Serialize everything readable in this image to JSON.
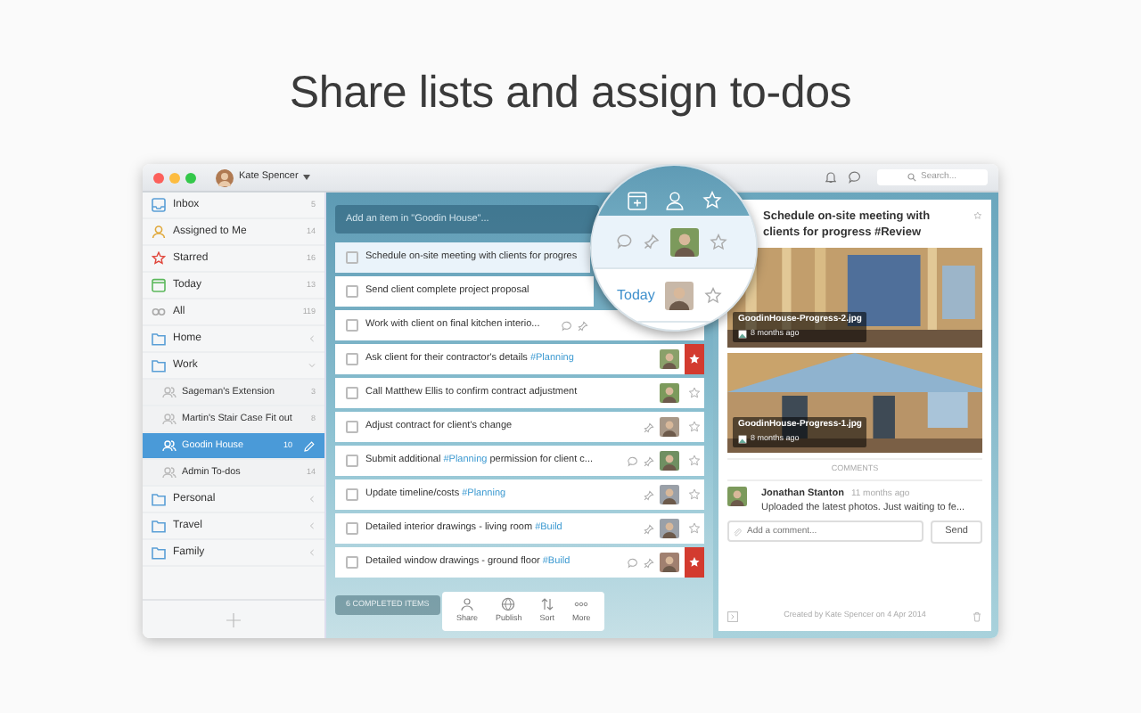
{
  "headline": "Share lists and assign to-dos",
  "window": {
    "user": "Kate Spencer",
    "search_placeholder": "Search..."
  },
  "sidebar": {
    "items": [
      {
        "label": "Inbox",
        "count": "5",
        "kind": "inbox",
        "selected": false
      },
      {
        "label": "Assigned to Me",
        "count": "14",
        "kind": "assigned",
        "selected": false
      },
      {
        "label": "Starred",
        "count": "16",
        "kind": "starred",
        "selected": false
      },
      {
        "label": "Today",
        "count": "13",
        "kind": "today",
        "selected": false
      },
      {
        "label": "All",
        "count": "119",
        "kind": "all",
        "selected": false
      },
      {
        "label": "Home",
        "kind": "folder",
        "expanded": false,
        "selected": false
      },
      {
        "label": "Work",
        "kind": "folder",
        "expanded": true,
        "selected": false,
        "children": [
          {
            "label": "Sageman's Extension",
            "count": "3",
            "kind": "shared",
            "selected": false
          },
          {
            "label": "Martin's Stair Case Fit out",
            "count": "8",
            "kind": "shared",
            "selected": false
          },
          {
            "label": "Goodin House",
            "count": "10",
            "kind": "shared",
            "selected": true
          },
          {
            "label": "Admin To-dos",
            "count": "14",
            "kind": "shared",
            "selected": false
          }
        ]
      },
      {
        "label": "Personal",
        "kind": "folder",
        "expanded": false,
        "selected": false
      },
      {
        "label": "Travel",
        "kind": "folder",
        "expanded": false,
        "selected": false
      },
      {
        "label": "Family",
        "kind": "folder",
        "expanded": false,
        "selected": false
      }
    ]
  },
  "list": {
    "add_placeholder": "Add an item in \"Goodin House\"...",
    "rows": [
      {
        "segments": [
          {
            "text": "Schedule on-site meeting with clients for progres",
            "kind": "plain"
          }
        ],
        "selected": true
      },
      {
        "segments": [
          {
            "text": "Send client complete project proposal",
            "kind": "plain"
          }
        ],
        "selected": false
      },
      {
        "segments": [
          {
            "text": "Work with client on final kitchen interio...",
            "kind": "plain"
          }
        ],
        "selected": false,
        "comment": true,
        "pin": true,
        "avatar": false
      },
      {
        "segments": [
          {
            "text": "Ask client for their contractor's details ",
            "kind": "plain"
          },
          {
            "text": "#Planning",
            "kind": "tag"
          }
        ],
        "selected": false,
        "avatar": true,
        "starred": true
      },
      {
        "segments": [
          {
            "text": "Call Matthew Ellis to confirm contract adjustment",
            "kind": "plain"
          }
        ],
        "selected": false,
        "avatar": true,
        "starred": false
      },
      {
        "segments": [
          {
            "text": "Adjust contract for client's change",
            "kind": "plain"
          }
        ],
        "selected": false,
        "pin": true,
        "avatar": true,
        "starred": false
      },
      {
        "segments": [
          {
            "text": "Submit additional ",
            "kind": "plain"
          },
          {
            "text": "#Planning",
            "kind": "tag"
          },
          {
            "text": " permission for client c...",
            "kind": "plain"
          }
        ],
        "selected": false,
        "comment": true,
        "pin": true,
        "avatar": true,
        "starred": false
      },
      {
        "segments": [
          {
            "text": "Update timeline/costs ",
            "kind": "plain"
          },
          {
            "text": "#Planning",
            "kind": "tag"
          }
        ],
        "selected": false,
        "pin": true,
        "avatar": true,
        "starred": false
      },
      {
        "segments": [
          {
            "text": "Detailed interior drawings - living room ",
            "kind": "plain"
          },
          {
            "text": "#Build",
            "kind": "tag"
          }
        ],
        "selected": false,
        "pin": true,
        "avatar": true,
        "starred": false
      },
      {
        "segments": [
          {
            "text": "Detailed window drawings - ground floor ",
            "kind": "plain"
          },
          {
            "text": "#Build",
            "kind": "tag"
          }
        ],
        "selected": false,
        "comment": true,
        "pin": true,
        "avatar": true,
        "starred": true
      }
    ],
    "completed_button": "6 COMPLETED ITEMS",
    "toolbar": [
      {
        "label": "Share",
        "kind": "share"
      },
      {
        "label": "Publish",
        "kind": "publish"
      },
      {
        "label": "Sort",
        "kind": "sort"
      },
      {
        "label": "More",
        "kind": "more"
      }
    ]
  },
  "lens": {
    "rows": [
      {
        "comment": true,
        "pin": true,
        "starred": false
      },
      {
        "due": "Today",
        "starred": false
      }
    ]
  },
  "detail": {
    "title": "Schedule on-site meeting with clients for progress #Review",
    "starred": false,
    "files": [
      {
        "name": "GoodinHouse-Progress-2.jpg",
        "age": "8 months ago"
      },
      {
        "name": "GoodinHouse-Progress-1.jpg",
        "age": "8 months ago"
      }
    ],
    "comments_heading": "COMMENTS",
    "comments": [
      {
        "author": "Jonathan Stanton",
        "time": "11 months ago",
        "text": "Uploaded the latest photos. Just waiting to fe..."
      }
    ],
    "comment_placeholder": "Add a comment...",
    "send": "Send",
    "created": "Created by Kate Spencer on 4 Apr 2014"
  }
}
